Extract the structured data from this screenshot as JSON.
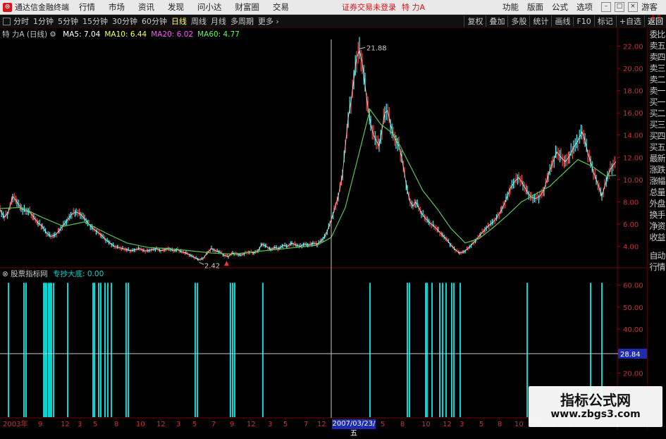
{
  "app": {
    "title": "通达信金融终端",
    "menu": [
      "行情",
      "市场",
      "资讯",
      "发现",
      "问小达",
      "财富圈",
      "交易"
    ],
    "notice": "证券交易未登录",
    "stock_short": "特 力A",
    "right_menu": [
      "功能",
      "版面",
      "公式",
      "选项"
    ],
    "guest": "游客"
  },
  "periodbar": {
    "periods": [
      "分时",
      "1分钟",
      "5分钟",
      "15分钟",
      "30分钟",
      "60分钟",
      "日线",
      "周线",
      "月线",
      "多周期",
      "更多"
    ],
    "active_index": 6,
    "tools": [
      "复权",
      "叠加",
      "多股",
      "统计",
      "画线",
      "F10",
      "标记",
      "+自选",
      "返回"
    ]
  },
  "main_chart": {
    "stock_label": "特 力A (日线)",
    "ma": [
      {
        "name": "MA5",
        "value": "7.04",
        "color": "#ffffff"
      },
      {
        "name": "MA10",
        "value": "6.44",
        "color": "#ffff54"
      },
      {
        "name": "MA20",
        "value": "6.02",
        "color": "#ff54ff"
      },
      {
        "name": "MA60",
        "value": "4.77",
        "color": "#54ff54"
      }
    ],
    "high_label": "21.88",
    "low_label": "2.42"
  },
  "indicator": {
    "name": "股票指标网",
    "line_label": "专抄大底: 0.00",
    "current_value": "28.84"
  },
  "sidebar": {
    "header": "L R",
    "items": [
      "委比",
      "卖五",
      "卖四",
      "卖三",
      "卖二",
      "卖一",
      "买一",
      "买二",
      "买三",
      "买四",
      "买五",
      "最新",
      "涨跌",
      "涨幅",
      "总量",
      "外盘",
      "换手",
      "净资",
      "收益",
      "自动",
      "行情"
    ]
  },
  "xaxis": {
    "labels": [
      "2003年",
      "9",
      "12",
      "3",
      "5",
      "8",
      "10",
      "12",
      "3",
      "5",
      "7",
      "9",
      "12",
      "3",
      "5",
      "7",
      "12",
      "2",
      "5",
      "8",
      "10",
      "12",
      "3",
      "5",
      "8",
      "10",
      "12",
      "3",
      "5"
    ],
    "cursor_date": "2007/03/23/五"
  },
  "watermark": {
    "line1": "指标公式网",
    "line2": "www.zbgs3.com"
  },
  "colors": {
    "up": "#ff5454",
    "down": "#54ffff",
    "ma60": "#54c854",
    "indicator": "#00d8d8",
    "brand": "#d8161c"
  },
  "chart_data": [
    {
      "type": "line",
      "y_axis_labels": [
        "22.00",
        "20.00",
        "18.00",
        "16.00",
        "14.00",
        "12.00",
        "10.00",
        "8.00",
        "6.00",
        "4.00"
      ],
      "ylim": [
        2.2,
        22.6
      ],
      "price": [
        [
          0,
          7.3
        ],
        [
          6,
          6.6
        ],
        [
          12,
          7.1
        ],
        [
          18,
          8.5
        ],
        [
          24,
          8.0
        ],
        [
          30,
          7.4
        ],
        [
          36,
          7.2
        ],
        [
          42,
          7.1
        ],
        [
          48,
          6.6
        ],
        [
          54,
          6.1
        ],
        [
          60,
          5.8
        ],
        [
          66,
          5.2
        ],
        [
          72,
          4.9
        ],
        [
          78,
          5.0
        ],
        [
          84,
          5.4
        ],
        [
          90,
          5.9
        ],
        [
          96,
          6.4
        ],
        [
          102,
          6.9
        ],
        [
          108,
          7.1
        ],
        [
          114,
          6.9
        ],
        [
          120,
          6.5
        ],
        [
          126,
          6.0
        ],
        [
          132,
          5.6
        ],
        [
          138,
          5.3
        ],
        [
          144,
          5.0
        ],
        [
          150,
          4.6
        ],
        [
          156,
          4.3
        ],
        [
          162,
          4.0
        ],
        [
          168,
          3.9
        ],
        [
          174,
          3.8
        ],
        [
          180,
          3.7
        ],
        [
          186,
          3.6
        ],
        [
          192,
          3.7
        ],
        [
          198,
          3.8
        ],
        [
          204,
          3.6
        ],
        [
          210,
          3.6
        ],
        [
          216,
          3.7
        ],
        [
          222,
          3.8
        ],
        [
          228,
          3.6
        ],
        [
          234,
          3.7
        ],
        [
          240,
          3.8
        ],
        [
          246,
          3.6
        ],
        [
          252,
          3.7
        ],
        [
          258,
          3.5
        ],
        [
          264,
          3.4
        ],
        [
          270,
          3.2
        ],
        [
          276,
          3.0
        ],
        [
          282,
          2.8
        ],
        [
          288,
          2.9
        ],
        [
          294,
          3.4
        ],
        [
          300,
          3.8
        ],
        [
          306,
          3.6
        ],
        [
          312,
          3.5
        ],
        [
          318,
          3.2
        ],
        [
          324,
          3.1
        ],
        [
          330,
          3.4
        ],
        [
          336,
          3.3
        ],
        [
          342,
          3.2
        ],
        [
          348,
          3.4
        ],
        [
          354,
          3.5
        ],
        [
          360,
          3.4
        ],
        [
          366,
          3.6
        ],
        [
          372,
          4.2
        ],
        [
          378,
          4.0
        ],
        [
          384,
          3.7
        ],
        [
          390,
          3.9
        ],
        [
          396,
          3.8
        ],
        [
          402,
          4.1
        ],
        [
          408,
          4.0
        ],
        [
          414,
          4.3
        ],
        [
          420,
          4.1
        ],
        [
          426,
          4.0
        ],
        [
          432,
          4.2
        ],
        [
          438,
          4.1
        ],
        [
          444,
          4.3
        ],
        [
          450,
          4.2
        ],
        [
          456,
          4.5
        ],
        [
          462,
          5.0
        ],
        [
          468,
          6.0
        ],
        [
          474,
          7.2
        ],
        [
          480,
          8.5
        ],
        [
          486,
          10.5
        ],
        [
          490,
          13.0
        ],
        [
          494,
          15.5
        ],
        [
          498,
          17.0
        ],
        [
          502,
          19.0
        ],
        [
          506,
          21.0
        ],
        [
          510,
          21.6
        ],
        [
          514,
          20.5
        ],
        [
          518,
          18.5
        ],
        [
          522,
          16.5
        ],
        [
          526,
          15.0
        ],
        [
          530,
          14.0
        ],
        [
          534,
          13.5
        ],
        [
          538,
          13.0
        ],
        [
          542,
          14.5
        ],
        [
          546,
          16.0
        ],
        [
          550,
          16.2
        ],
        [
          554,
          15.0
        ],
        [
          558,
          14.0
        ],
        [
          562,
          13.5
        ],
        [
          566,
          13.0
        ],
        [
          570,
          12.0
        ],
        [
          574,
          10.5
        ],
        [
          578,
          9.0
        ],
        [
          582,
          8.0
        ],
        [
          586,
          7.6
        ],
        [
          590,
          8.0
        ],
        [
          594,
          7.5
        ],
        [
          598,
          7.0
        ],
        [
          604,
          6.5
        ],
        [
          610,
          6.1
        ],
        [
          616,
          5.8
        ],
        [
          622,
          5.4
        ],
        [
          628,
          5.0
        ],
        [
          634,
          4.6
        ],
        [
          640,
          4.1
        ],
        [
          646,
          3.7
        ],
        [
          652,
          3.4
        ],
        [
          658,
          3.5
        ],
        [
          664,
          3.8
        ],
        [
          670,
          4.2
        ],
        [
          676,
          4.6
        ],
        [
          682,
          5.1
        ],
        [
          688,
          5.5
        ],
        [
          694,
          5.9
        ],
        [
          700,
          6.2
        ],
        [
          706,
          6.7
        ],
        [
          712,
          7.3
        ],
        [
          718,
          8.2
        ],
        [
          724,
          9.2
        ],
        [
          730,
          9.8
        ],
        [
          736,
          10.2
        ],
        [
          742,
          9.6
        ],
        [
          748,
          8.9
        ],
        [
          754,
          8.4
        ],
        [
          760,
          8.3
        ],
        [
          766,
          8.5
        ],
        [
          772,
          9.1
        ],
        [
          778,
          10.4
        ],
        [
          784,
          11.5
        ],
        [
          790,
          12.5
        ],
        [
          796,
          12.0
        ],
        [
          802,
          11.6
        ],
        [
          808,
          12.1
        ],
        [
          814,
          12.9
        ],
        [
          820,
          13.5
        ],
        [
          826,
          14.3
        ],
        [
          830,
          13.5
        ],
        [
          834,
          12.4
        ],
        [
          838,
          11.6
        ],
        [
          842,
          10.7
        ],
        [
          846,
          10.0
        ],
        [
          850,
          9.3
        ],
        [
          854,
          8.5
        ],
        [
          858,
          9.4
        ],
        [
          862,
          10.3
        ],
        [
          866,
          10.9
        ],
        [
          870,
          11.3
        ],
        [
          874,
          11.6
        ]
      ],
      "ma60": [
        [
          0,
          7.4
        ],
        [
          30,
          7.5
        ],
        [
          60,
          6.6
        ],
        [
          90,
          5.8
        ],
        [
          120,
          6.2
        ],
        [
          150,
          5.2
        ],
        [
          180,
          4.3
        ],
        [
          210,
          3.9
        ],
        [
          240,
          3.8
        ],
        [
          270,
          3.6
        ],
        [
          300,
          3.4
        ],
        [
          330,
          3.3
        ],
        [
          360,
          3.5
        ],
        [
          390,
          3.7
        ],
        [
          420,
          3.9
        ],
        [
          450,
          4.1
        ],
        [
          470,
          4.8
        ],
        [
          490,
          7.5
        ],
        [
          510,
          12.5
        ],
        [
          525,
          16.3
        ],
        [
          540,
          15.0
        ],
        [
          560,
          14.0
        ],
        [
          580,
          11.5
        ],
        [
          600,
          9.0
        ],
        [
          620,
          7.4
        ],
        [
          640,
          5.6
        ],
        [
          660,
          4.3
        ],
        [
          680,
          4.7
        ],
        [
          700,
          5.7
        ],
        [
          720,
          6.8
        ],
        [
          740,
          8.0
        ],
        [
          760,
          8.7
        ],
        [
          780,
          9.4
        ],
        [
          800,
          10.6
        ],
        [
          820,
          11.8
        ],
        [
          840,
          11.2
        ],
        [
          860,
          10.3
        ],
        [
          874,
          10.4
        ]
      ]
    },
    {
      "type": "bar",
      "y_axis_labels": [
        "60.00",
        "50.00",
        "40.00",
        "30.00",
        "20.00"
      ],
      "ylim": [
        0,
        64
      ],
      "reference_line": 28.84,
      "spikes": [
        [
          12,
          61
        ],
        [
          34,
          61
        ],
        [
          37,
          61
        ],
        [
          62,
          61
        ],
        [
          64,
          61
        ],
        [
          66,
          61
        ],
        [
          69,
          61
        ],
        [
          71,
          61
        ],
        [
          73,
          61
        ],
        [
          76,
          61
        ],
        [
          96,
          61
        ],
        [
          132,
          61
        ],
        [
          134,
          61
        ],
        [
          140,
          61
        ],
        [
          143,
          61
        ],
        [
          149,
          61
        ],
        [
          153,
          61
        ],
        [
          158,
          61
        ],
        [
          179,
          61
        ],
        [
          182,
          61
        ],
        [
          277,
          61
        ],
        [
          280,
          61
        ],
        [
          327,
          61
        ],
        [
          330,
          61
        ],
        [
          333,
          61
        ],
        [
          373,
          61
        ],
        [
          525,
          61
        ],
        [
          578,
          61
        ],
        [
          581,
          61
        ],
        [
          604,
          61
        ],
        [
          606,
          61
        ],
        [
          613,
          61
        ],
        [
          624,
          61
        ],
        [
          628,
          61
        ],
        [
          633,
          61
        ],
        [
          641,
          61
        ],
        [
          644,
          61
        ],
        [
          653,
          61
        ],
        [
          748,
          61
        ],
        [
          838,
          61
        ],
        [
          854,
          61
        ]
      ]
    }
  ]
}
